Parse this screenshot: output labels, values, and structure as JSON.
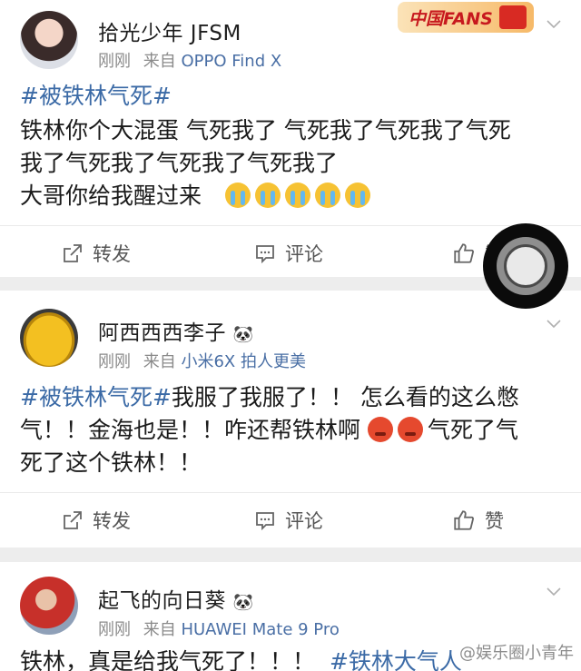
{
  "posts": [
    {
      "username": "拾光少年 JFSM",
      "time": "刚刚",
      "from_label": "来自",
      "source": "OPPO Find X",
      "body_line1_tag": "#被铁林气死#",
      "body_line2": "铁林你个大混蛋 气死我了 气死我了气死我了气死",
      "body_line3": "我了气死我了气死我了气死我了",
      "body_line4": "大哥你给我醒过来",
      "emojis": [
        "cry-emoji",
        "cry-emoji",
        "cry-emoji",
        "cry-emoji",
        "cry-emoji"
      ],
      "repost_label": "转发",
      "comment_label": "评论",
      "like_label": "赞",
      "badge_text": "中国FANS"
    },
    {
      "username": "阿西西西李子",
      "time": "刚刚",
      "from_label": "来自",
      "source": "小米6X 拍人更美",
      "body_tag": "#被铁林气死#",
      "body_line1_rest": "我服了我服了！！ 怎么看的这么憋",
      "body_line2_a": "气！！金海也是！！咋还帮铁林啊",
      "body_line2_b": "气死了气",
      "body_line3": "死了这个铁林！！",
      "repost_label": "转发",
      "comment_label": "评论",
      "like_label": "赞"
    },
    {
      "username": "起飞的向日葵",
      "time": "刚刚",
      "from_label": "来自",
      "source": "HUAWEI Mate 9 Pro",
      "body_start": "铁林，真是给我气死了！！！",
      "body_tag": "#铁林大气人"
    }
  ],
  "watermark": "@娱乐圈小青年",
  "colors": {
    "link": "#3b6aa6",
    "source": "#4a6fa5",
    "meta": "#8a8a8a"
  },
  "icons": [
    "repost-icon",
    "comment-icon",
    "like-icon",
    "chevron-down-icon",
    "panda-icon",
    "assistive-touch-icon"
  ]
}
